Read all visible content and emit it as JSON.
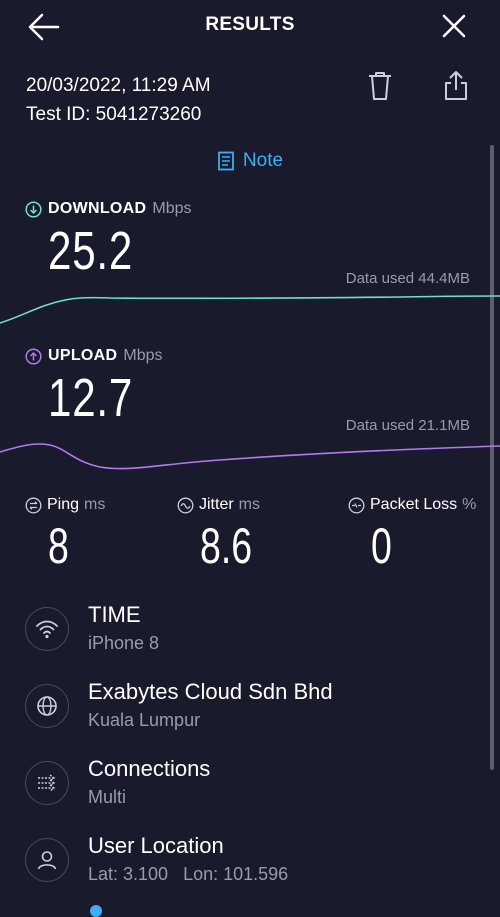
{
  "header": {
    "title": "RESULTS"
  },
  "test": {
    "datetime": "20/03/2022, 11:29 AM",
    "test_id": "Test ID: 5041273260"
  },
  "note": {
    "label": "Note"
  },
  "download": {
    "label": "DOWNLOAD",
    "unit": "Mbps",
    "value": "25.2",
    "data_used": "Data used 44.4MB"
  },
  "upload": {
    "label": "UPLOAD",
    "unit": "Mbps",
    "value": "12.7",
    "data_used": "Data used 21.1MB"
  },
  "stats": {
    "ping": {
      "label": "Ping",
      "unit": "ms",
      "value": "8"
    },
    "jitter": {
      "label": "Jitter",
      "unit": "ms",
      "value": "8.6"
    },
    "packet_loss": {
      "label": "Packet Loss",
      "unit": "%",
      "value": "0"
    }
  },
  "details": [
    {
      "icon": "wifi-icon",
      "title": "TIME",
      "subtitle": "iPhone 8"
    },
    {
      "icon": "globe-icon",
      "title": "Exabytes Cloud Sdn Bhd",
      "subtitle": "Kuala Lumpur"
    },
    {
      "icon": "connections-icon",
      "title": "Connections",
      "subtitle": "Multi"
    },
    {
      "icon": "user-icon",
      "title": "User Location",
      "subtitle": "Lat: 3.100   Lon: 101.596"
    }
  ],
  "colors": {
    "background": "#1a1a2d",
    "download_accent": "#6ee0d0",
    "upload_accent": "#b279f0",
    "link": "#3aaef6",
    "muted": "#9a9aab"
  }
}
